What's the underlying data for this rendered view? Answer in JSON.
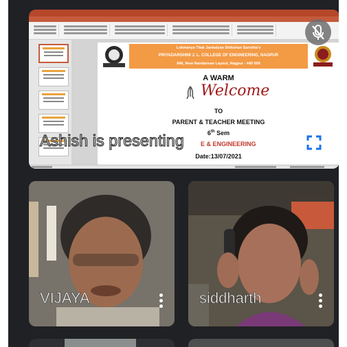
{
  "presentation": {
    "presenter_caption": "Ashish is presenting",
    "slide": {
      "banner_line1": "Lokmanya Tilak Jankalyan Shikshan Sanstha's",
      "banner_line2": "PRIYADARSHINI J. L. COLLEGE OF ENGINEERING, NAGPUR",
      "banner_line3": "846, New Nandanvan Layout, Nagpur - 440 009",
      "warm": "A WARM",
      "welcome": "Welcome",
      "to": "TO",
      "meeting": "PARENT & TEACHER MEETING",
      "sem_number": "6",
      "sem_sup": "th",
      "sem_word": "Sem",
      "department": "E & ENGINEERING",
      "date": "Date:13/07/2021"
    }
  },
  "participants": [
    {
      "name": "VIJAYA"
    },
    {
      "name": "siddharth"
    }
  ],
  "colors": {
    "meeting_bg": "#202124",
    "slide_banner": "#f39a45",
    "welcome_text": "#a01a1a",
    "department_text": "#c0392b",
    "fullscreen_icon": "#1a73e8"
  },
  "icons": {
    "mute": "mic-off-icon",
    "fullscreen": "fullscreen-icon",
    "participant_menu": "more-vert-icon"
  }
}
